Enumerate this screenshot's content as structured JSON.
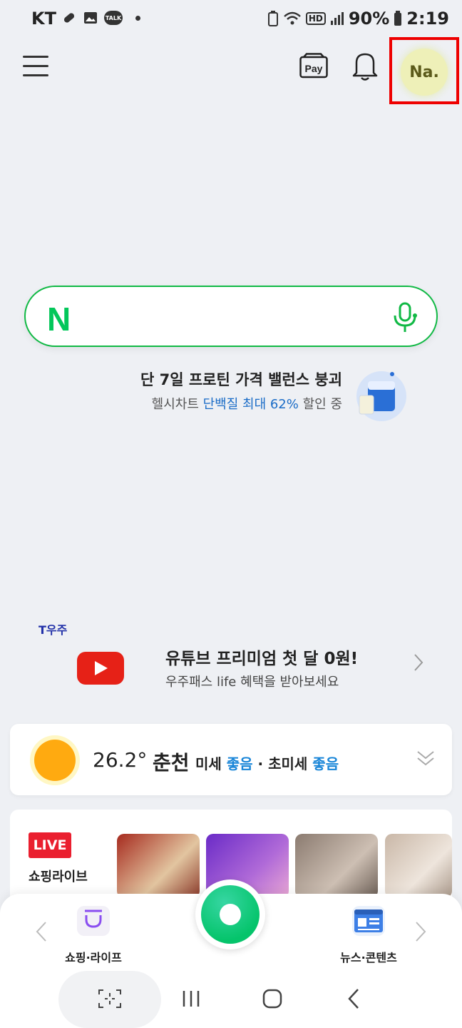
{
  "status_bar": {
    "carrier": "KT",
    "battery": "90%",
    "time": "2:19",
    "hd_label": "HD",
    "talk_label": "TALK"
  },
  "header": {
    "pay_label": "Pay",
    "profile_initials": "Na."
  },
  "search": {
    "logo": "N",
    "placeholder": ""
  },
  "promo": {
    "title": "단 7일 프로틴 가격 밸런스 붕괴",
    "sub_prefix": "헬시차트 ",
    "sub_highlight": "단백질 최대 62%",
    "sub_suffix": " 할인 중"
  },
  "ad": {
    "brand": "T우주",
    "title": "유튜브 프리미엄 첫 달 0원!",
    "subtitle": "우주패스 life 혜택을 받아보세요"
  },
  "weather": {
    "temperature": "26.2°",
    "city": "춘천",
    "fine_dust_label": "미세",
    "fine_dust_value": "좋음",
    "separator": " · ",
    "ultrafine_dust_label": "초미세",
    "ultrafine_dust_value": "좋음"
  },
  "shopping": {
    "badge": "LIVE",
    "label": "쇼핑라이브"
  },
  "bottom_nav": {
    "left_label": "쇼핑·라이프",
    "right_label": "뉴스·콘텐츠"
  },
  "colors": {
    "naver_green": "#03c75a",
    "highlight_red": "#e00000",
    "link_blue": "#1a86d8",
    "live_red": "#ea1f2f"
  }
}
